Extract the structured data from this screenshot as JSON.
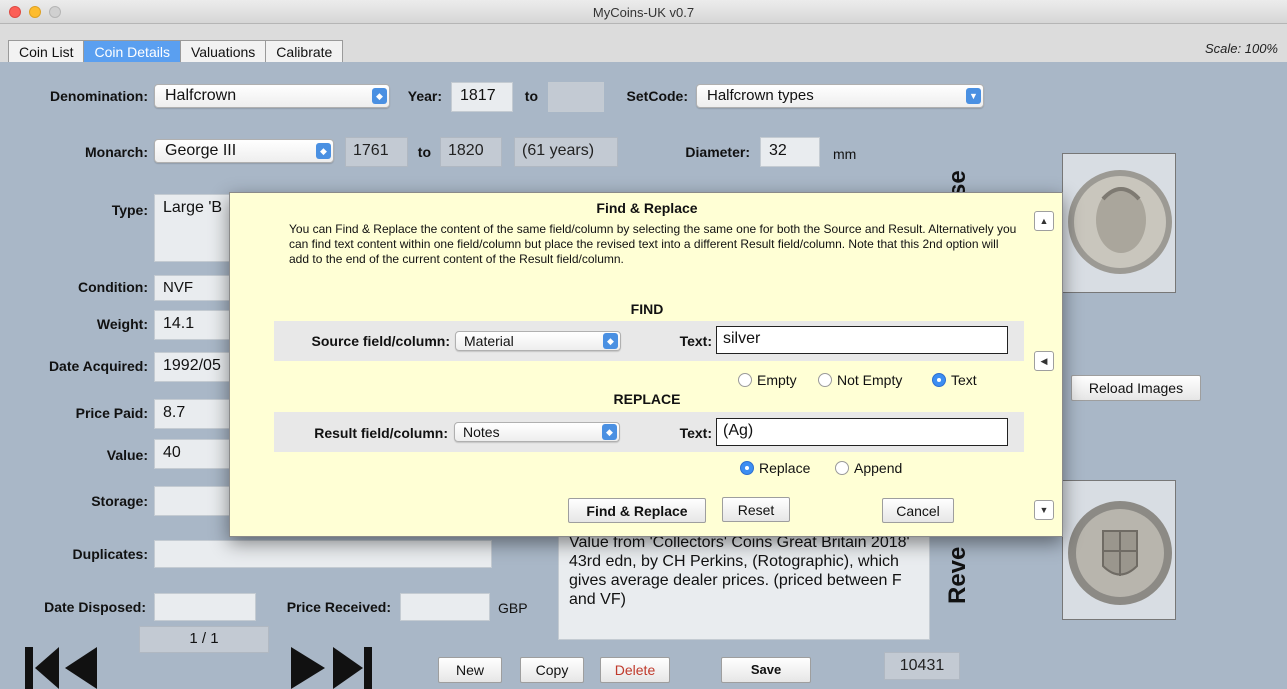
{
  "window": {
    "title": "MyCoins-UK v0.7"
  },
  "tabs": [
    {
      "label": "Coin List",
      "active": false
    },
    {
      "label": "Coin Details",
      "active": true
    },
    {
      "label": "Valuations",
      "active": false
    },
    {
      "label": "Calibrate",
      "active": false
    }
  ],
  "scale_label": "Scale: 100%",
  "form": {
    "denomination_label": "Denomination:",
    "denomination_value": "Halfcrown",
    "year_label": "Year:",
    "year_from": "1817",
    "year_to_label": "to",
    "year_to": "",
    "setcode_label": "SetCode:",
    "setcode_value": "Halfcrown types",
    "monarch_label": "Monarch:",
    "monarch_value": "George III",
    "reign_from": "1761",
    "reign_to_label": "to",
    "reign_to": "1820",
    "reign_years": "(61 years)",
    "diameter_label": "Diameter:",
    "diameter_value": "32",
    "diameter_unit": "mm",
    "type_label": "Type:",
    "type_value": "Large 'B",
    "condition_label": "Condition:",
    "condition_value": "NVF",
    "weight_label": "Weight:",
    "weight_value": "14.1",
    "date_acquired_label": "Date Acquired:",
    "date_acquired_value": "1992/05",
    "price_paid_label": "Price Paid:",
    "price_paid_value": "8.7",
    "value_label": "Value:",
    "value_value": "40",
    "storage_label": "Storage:",
    "storage_value": "",
    "duplicates_label": "Duplicates:",
    "duplicates_value": "",
    "date_disposed_label": "Date Disposed:",
    "date_disposed_value": "",
    "price_received_label": "Price Received:",
    "price_received_value": "",
    "currency": "GBP",
    "notes_value": "Value from 'Collectors' Coins Great Britain 2018' 43rd edn, by CH Perkins, (Rotographic), which gives average dealer prices. (priced between F and VF)",
    "obverse_partial": "se",
    "reverse_partial": "Reve",
    "reload_images": "Reload Images"
  },
  "footer": {
    "counter": "1 / 1",
    "new": "New",
    "copy": "Copy",
    "delete": "Delete",
    "save": "Save",
    "record_id": "10431"
  },
  "dialog": {
    "title": "Find & Replace",
    "description": "You can Find & Replace the content of the same field/column by selecting the same one for both the Source and Result. Alternatively you can find text content within one field/column but place the revised text into a different Result field/column. Note that this 2nd option will add to the end of the current content of the Result field/column.",
    "find_title": "FIND",
    "source_label": "Source field/column:",
    "source_value": "Material",
    "find_text_label": "Text:",
    "find_text_value": "silver",
    "find_options": [
      {
        "label": "Empty",
        "selected": false
      },
      {
        "label": "Not Empty",
        "selected": false
      },
      {
        "label": "Text",
        "selected": true
      }
    ],
    "replace_title": "REPLACE",
    "result_label": "Result field/column:",
    "result_value": "Notes",
    "replace_text_label": "Text:",
    "replace_text_value": "(Ag)",
    "replace_options": [
      {
        "label": "Replace",
        "selected": true
      },
      {
        "label": "Append",
        "selected": false
      }
    ],
    "find_replace_button": "Find & Replace",
    "reset_button": "Reset",
    "cancel_button": "Cancel"
  },
  "colors": {
    "background": "#a9b7c7",
    "dialog_bg": "#ffffd5",
    "accent": "#4a90e2",
    "delete_text": "#c0392b"
  }
}
